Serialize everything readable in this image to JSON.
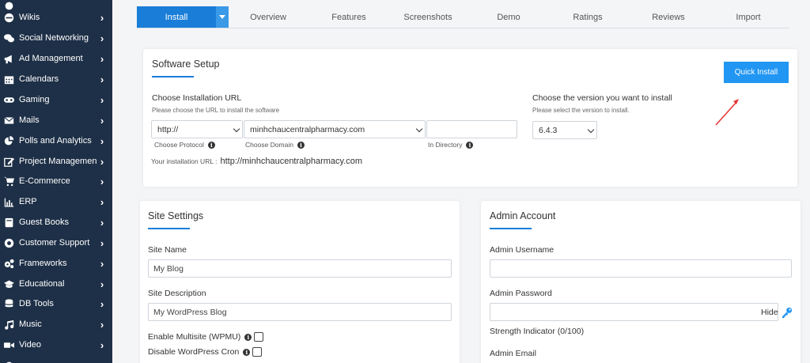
{
  "sidebar": {
    "items": [
      {
        "label": "Wikis",
        "icon": "globe-icon"
      },
      {
        "label": "Social Networking",
        "icon": "chat-bubbles-icon"
      },
      {
        "label": "Ad Management",
        "icon": "megaphone-icon"
      },
      {
        "label": "Calendars",
        "icon": "calendar-icon"
      },
      {
        "label": "Gaming",
        "icon": "gamepad-icon"
      },
      {
        "label": "Mails",
        "icon": "envelope-icon"
      },
      {
        "label": "Polls and Analytics",
        "icon": "pie-chart-icon"
      },
      {
        "label": "Project Management",
        "icon": "edit-icon"
      },
      {
        "label": "E-Commerce",
        "icon": "cart-icon"
      },
      {
        "label": "ERP",
        "icon": "bar-chart-icon"
      },
      {
        "label": "Guest Books",
        "icon": "book-icon"
      },
      {
        "label": "Customer Support",
        "icon": "lifebuoy-icon"
      },
      {
        "label": "Frameworks",
        "icon": "cogs-icon"
      },
      {
        "label": "Educational",
        "icon": "graduation-cap-icon"
      },
      {
        "label": "DB Tools",
        "icon": "database-icon"
      },
      {
        "label": "Music",
        "icon": "music-icon"
      },
      {
        "label": "Video",
        "icon": "video-camera-icon"
      }
    ],
    "chevron": "›",
    "bg_color": "#1e3047"
  },
  "tabs": [
    {
      "label": "Install",
      "active": true
    },
    {
      "label": "Overview"
    },
    {
      "label": "Features"
    },
    {
      "label": "Screenshots"
    },
    {
      "label": "Demo"
    },
    {
      "label": "Ratings"
    },
    {
      "label": "Reviews"
    },
    {
      "label": "Import"
    }
  ],
  "software_setup": {
    "title": "Software Setup",
    "quick_install_label": "Quick Install",
    "url_label": "Choose Installation URL",
    "url_sublabel": "Please choose the URL to install the software",
    "protocol_value": "http://",
    "domain_value": "minhchaucentralpharmacy.com",
    "directory_value": "",
    "protocol_hint": "Choose Protocol",
    "domain_hint": "Choose Domain",
    "directory_hint": "In Directory",
    "install_url_label": "Your installation URL :",
    "install_url_value": "http://minhchaucentralpharmacy.com",
    "version_label": "Choose the version you want to install",
    "version_sublabel": "Please select the version to install.",
    "version_value": "6.4.3"
  },
  "site_settings": {
    "title": "Site Settings",
    "site_name_label": "Site Name",
    "site_name_value": "My Blog",
    "site_desc_label": "Site Description",
    "site_desc_value": "My WordPress Blog",
    "multisite_label": "Enable Multisite (WPMU)",
    "cron_label": "Disable WordPress Cron"
  },
  "admin_account": {
    "title": "Admin Account",
    "username_label": "Admin Username",
    "username_value": "",
    "password_label": "Admin Password",
    "password_value": "",
    "hide_label": "Hide",
    "strength_label": "Strength Indicator (0/100)",
    "email_label": "Admin Email"
  },
  "colors": {
    "accent": "#1a7dd8",
    "button": "#2196f3",
    "arrow": "#e53935"
  }
}
